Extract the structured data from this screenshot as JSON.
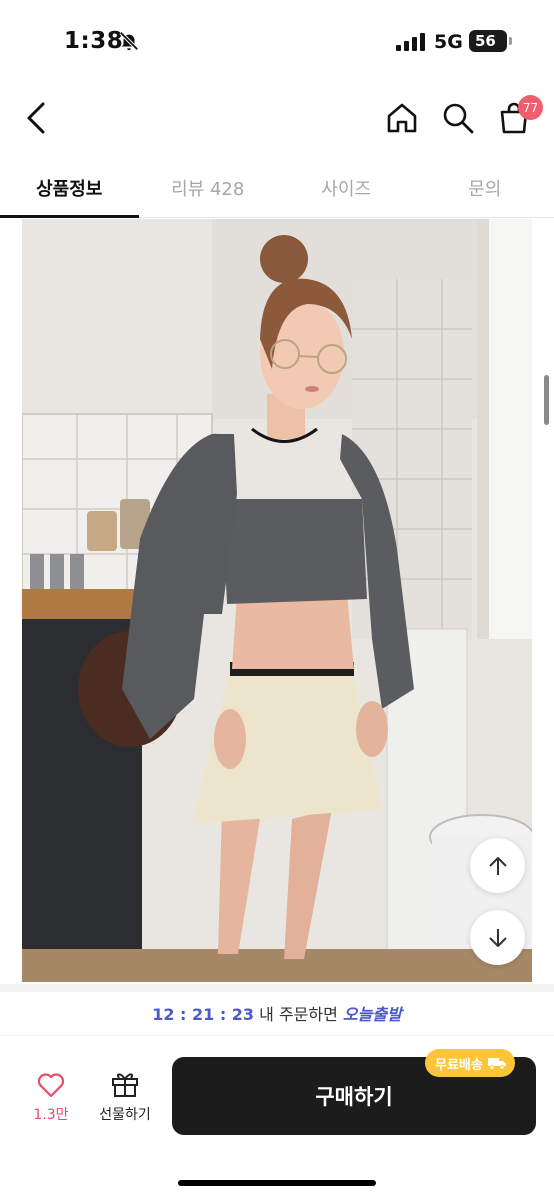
{
  "status_bar": {
    "time": "1:38",
    "network": "5G",
    "battery": "56"
  },
  "header": {
    "cart_badge": "77"
  },
  "tabs": [
    {
      "label": "상품정보",
      "active": true
    },
    {
      "label": "리뷰 428",
      "active": false
    },
    {
      "label": "사이즈",
      "active": false
    },
    {
      "label": "문의",
      "active": false
    }
  ],
  "delivery": {
    "timer": "12 : 21 : 23",
    "text": " 내 주문하면 ",
    "today": "오늘출발"
  },
  "bottom_bar": {
    "like_count": "1.3만",
    "gift_label": "선물하기",
    "buy_label": "구매하기",
    "free_shipping_badge": "무료배송"
  },
  "colors": {
    "accent_blue": "#4a5ac8",
    "like_red": "#e84a67",
    "badge_red": "#ef5d6e",
    "free_ship_yellow": "#ffc53a",
    "buy_button": "#1c1c1c"
  }
}
